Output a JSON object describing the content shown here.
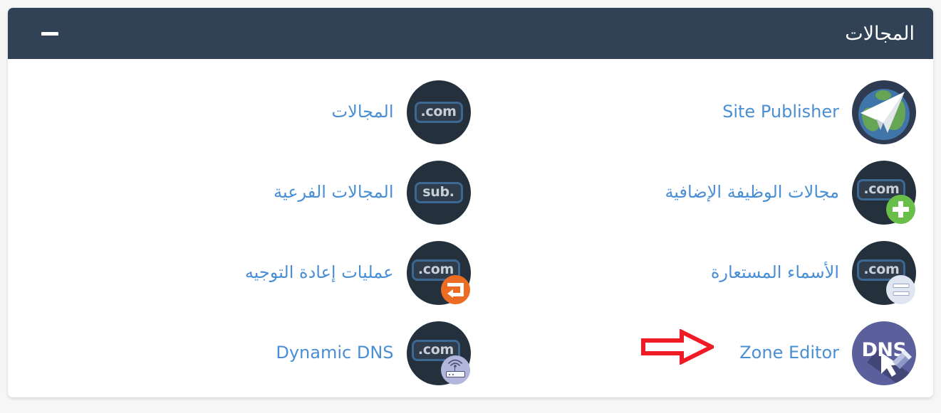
{
  "header": {
    "title": "المجالات",
    "collapse_label": "—",
    "background_color": "#324256",
    "title_color": "#ffffff"
  },
  "theme": {
    "page_background": "#f6f6f7",
    "card_background": "#ffffff",
    "link_color": "#4a8fd4",
    "annotation_color": "#ee1c25",
    "icon_dark": "#25303d",
    "badge_border": "#3c6894",
    "green_badge": "#6abf4b",
    "orange_badge": "#ec6c23",
    "dns_purple": "#5b5f9c"
  },
  "items": [
    {
      "label": "Site Publisher",
      "icon": "site-publisher-icon",
      "dir": "ltr",
      "column": "right",
      "row": 1
    },
    {
      "label": "المجالات",
      "icon": "domains-com-icon",
      "badge_text": ".com",
      "dir": "rtl",
      "column": "left",
      "row": 1
    },
    {
      "label": "مجالات الوظيفة الإضافية",
      "icon": "addon-domains-icon",
      "badge_text": ".com",
      "sub_badge": "plus-icon",
      "dir": "rtl",
      "column": "right",
      "row": 2
    },
    {
      "label": "المجالات الفرعية",
      "icon": "subdomains-icon",
      "badge_text": "sub.",
      "dir": "rtl",
      "column": "left",
      "row": 2
    },
    {
      "label": "الأسماء المستعارة",
      "icon": "aliases-icon",
      "badge_text": ".com",
      "sub_badge": "equals-icon",
      "dir": "rtl",
      "column": "right",
      "row": 3
    },
    {
      "label": "عمليات إعادة التوجيه",
      "icon": "redirects-icon",
      "badge_text": ".com",
      "sub_badge": "redirect-arrow-icon",
      "dir": "rtl",
      "column": "left",
      "row": 3
    },
    {
      "label": "Zone Editor",
      "icon": "zone-editor-dns-icon",
      "badge_text": "DNS",
      "dir": "ltr",
      "column": "right",
      "row": 4
    },
    {
      "label": "Dynamic DNS",
      "icon": "dynamic-dns-icon",
      "badge_text": ".com",
      "sub_badge": "router-icon",
      "dir": "ltr",
      "column": "left",
      "row": 4
    }
  ],
  "annotation": {
    "type": "arrow",
    "direction": "right",
    "points_to": "Zone Editor",
    "color": "#ee1c25"
  }
}
